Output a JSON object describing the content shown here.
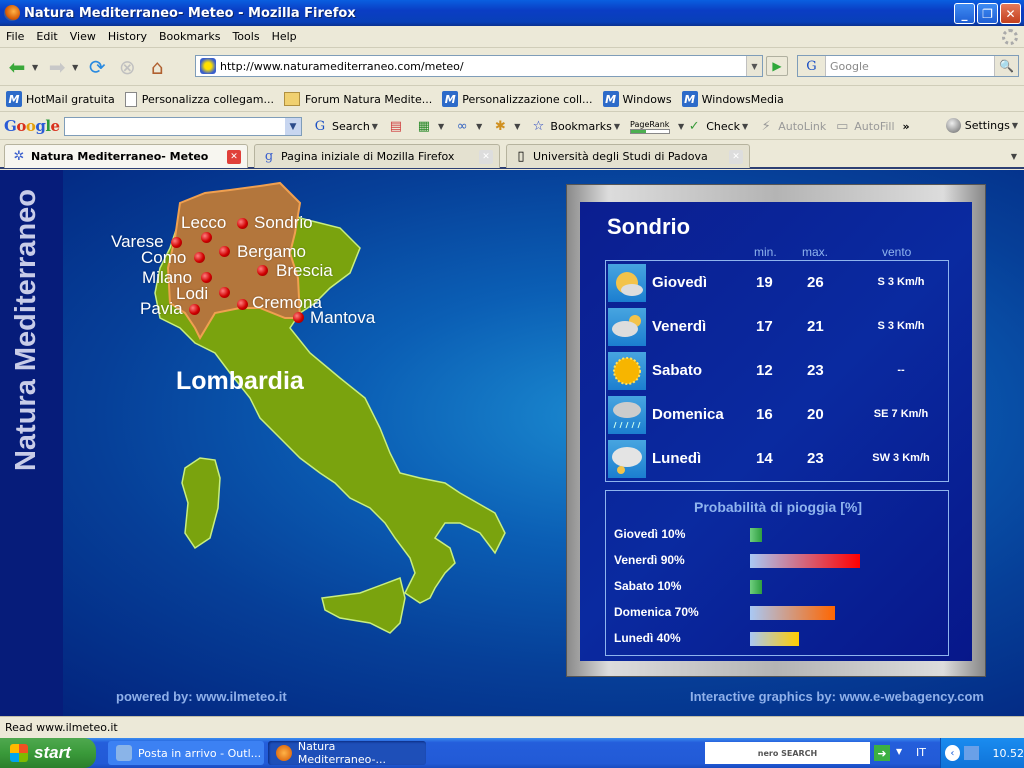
{
  "window": {
    "title": "Natura Mediterraneo- Meteo - Mozilla Firefox",
    "controls": [
      "minimize",
      "restore",
      "close"
    ]
  },
  "menu": [
    "File",
    "Edit",
    "View",
    "History",
    "Bookmarks",
    "Tools",
    "Help"
  ],
  "nav": {
    "url": "http://www.naturamediterraneo.com/meteo/",
    "search_engine": "G",
    "search_placeholder": "Google"
  },
  "bookmarks": [
    {
      "label": "HotMail gratuita",
      "icon": "msn-icon"
    },
    {
      "label": "Personalizza collegam...",
      "icon": "page-icon"
    },
    {
      "label": "Forum Natura Medite...",
      "icon": "folder-icon"
    },
    {
      "label": "Personalizzazione coll...",
      "icon": "msn-icon"
    },
    {
      "label": "Windows",
      "icon": "msn-icon"
    },
    {
      "label": "WindowsMedia",
      "icon": "msn-icon"
    }
  ],
  "google_toolbar": {
    "logo": "Google",
    "search_label": "Search",
    "bookmarks_label": "Bookmarks",
    "pagerank_label": "PageRank",
    "pagerank_fill": 0.4,
    "check_label": "Check",
    "autolink_label": "AutoLink",
    "autofill_label": "AutoFill",
    "more": "»",
    "settings_label": "Settings"
  },
  "tabs": [
    {
      "label": "Natura Mediterraneo- Meteo",
      "active": true
    },
    {
      "label": "Pagina iniziale di Mozilla Firefox",
      "active": false
    },
    {
      "label": "Università degli Studi di Padova",
      "active": false
    }
  ],
  "page": {
    "brand": "Natura Mediterraneo",
    "region": "Lombardia",
    "cities": [
      "Lecco",
      "Sondrio",
      "Varese",
      "Como",
      "Bergamo",
      "Milano",
      "Brescia",
      "Lodi",
      "Cremona",
      "Pavia",
      "Mantova"
    ],
    "powered_by": "powered by: www.ilmeteo.it",
    "graphics_by": "Interactive graphics by: www.e-webagency.com",
    "forecast": {
      "city": "Sondrio",
      "col_min": "min.",
      "col_max": "max.",
      "col_wind": "vento",
      "days": [
        {
          "day": "Giovedì",
          "min": "19",
          "max": "26",
          "wind": "S  3 Km/h",
          "icon": "partly-sunny-icon"
        },
        {
          "day": "Venerdì",
          "min": "17",
          "max": "21",
          "wind": "S  3 Km/h",
          "icon": "cloudy-sun-icon"
        },
        {
          "day": "Sabato",
          "min": "12",
          "max": "23",
          "wind": "--",
          "icon": "sunny-icon"
        },
        {
          "day": "Domenica",
          "min": "16",
          "max": "20",
          "wind": "SE  7 Km/h",
          "icon": "rain-icon"
        },
        {
          "day": "Lunedì",
          "min": "14",
          "max": "23",
          "wind": "SW  3 Km/h",
          "icon": "storm-icon"
        }
      ]
    },
    "rain": {
      "title": "Probabilità di pioggia [%]",
      "rows": [
        {
          "label": "Giovedì 10%",
          "value": 10,
          "color": "#2e9e3e"
        },
        {
          "label": "Venerdì 90%",
          "value": 90,
          "color": "#ff0000"
        },
        {
          "label": "Sabato 10%",
          "value": 10,
          "color": "#2e9e3e"
        },
        {
          "label": "Domenica 70%",
          "value": 70,
          "color": "#ff6600"
        },
        {
          "label": "Lunedì 40%",
          "value": 40,
          "color": "#ffcc00"
        }
      ]
    }
  },
  "status": "Read www.ilmeteo.it",
  "taskbar": {
    "start": "start",
    "items": [
      "Posta in arrivo - Outl...",
      "Natura Mediterraneo-..."
    ],
    "nero": "nero SEARCH",
    "lang": "IT",
    "clock": "10.52"
  }
}
